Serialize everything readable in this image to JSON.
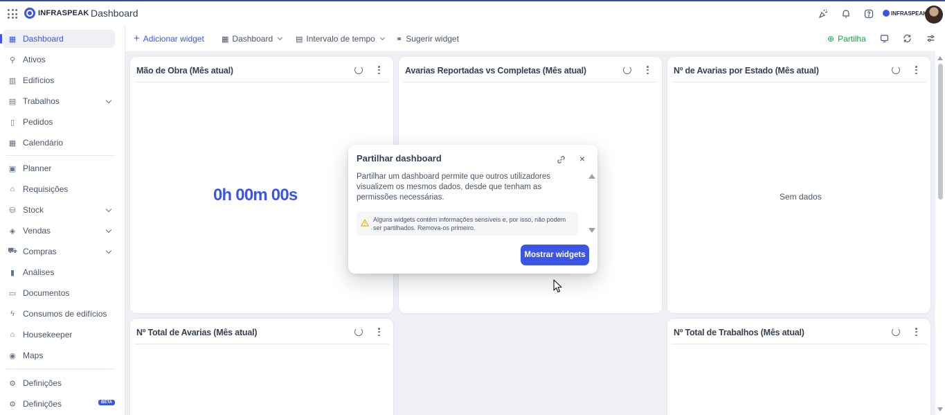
{
  "header": {
    "app_menu_icon": "apps-grid-icon",
    "logo_text": "INFRASPEAK",
    "page_title": "Dashboard",
    "icons": [
      "announcement-icon",
      "bell-icon",
      "help-icon"
    ],
    "brand_badge": "INFRASPEAK"
  },
  "sidebar": {
    "items": [
      {
        "label": "Dashboard",
        "icon": "dashboard-icon",
        "active": true
      },
      {
        "label": "Ativos",
        "icon": "assets-icon"
      },
      {
        "label": "Edifícios",
        "icon": "building-icon"
      },
      {
        "label": "Trabalhos",
        "icon": "works-icon",
        "expandable": true
      },
      {
        "label": "Pedidos",
        "icon": "requests-icon"
      },
      {
        "label": "Calendário",
        "icon": "calendar-icon"
      },
      {
        "label": "Planner",
        "icon": "planner-icon"
      },
      {
        "label": "Requisições",
        "icon": "requisitions-icon"
      },
      {
        "label": "Stock",
        "icon": "stock-icon",
        "expandable": true
      },
      {
        "label": "Vendas",
        "icon": "sales-icon",
        "expandable": true
      },
      {
        "label": "Compras",
        "icon": "cart-icon",
        "expandable": true
      },
      {
        "label": "Análises",
        "icon": "analytics-icon"
      },
      {
        "label": "Documentos",
        "icon": "documents-icon"
      },
      {
        "label": "Consumos de edifícios",
        "icon": "bolt-icon"
      },
      {
        "label": "Housekeeper",
        "icon": "housekeeper-icon"
      },
      {
        "label": "Maps",
        "icon": "map-pin-icon"
      },
      {
        "label": "Definições",
        "icon": "settings-icon"
      },
      {
        "label": "Definições",
        "icon": "settings-icon",
        "badge": "BETA"
      }
    ]
  },
  "toolbar": {
    "add_widget": "Adicionar widget",
    "dashboard_select": "Dashboard",
    "time_range": "Intervalo de tempo",
    "suggest_widget": "Sugerir widget",
    "share": "Partilha"
  },
  "cards": [
    {
      "title": "Mão de Obra (Mês atual)",
      "value": "0h 00m 00s"
    },
    {
      "title": "Avarias Reportadas vs Completas (Mês atual)"
    },
    {
      "title": "Nº de Avarias por Estado (Mês atual)",
      "empty_text": "Sem dados"
    },
    {
      "title": "Nº Total de Avarias (Mês atual)"
    },
    {
      "title": "Nº Total de Trabalhos (Mês atual)"
    }
  ],
  "modal": {
    "title": "Partilhar dashboard",
    "body": "Partilhar um dashboard permite que outros utilizadores visualizem os mesmos dados, desde que tenham as permissões necessárias.",
    "warning": "Alguns widgets contêm informações sensíveis e, por isso, não podem ser partilhados. Remova-os primeiro.",
    "button": "Mostrar widgets"
  },
  "colors": {
    "accent": "#3b55e6",
    "share_green": "#16a34a",
    "warning_yellow": "#eab308",
    "background": "#eef0f5"
  }
}
